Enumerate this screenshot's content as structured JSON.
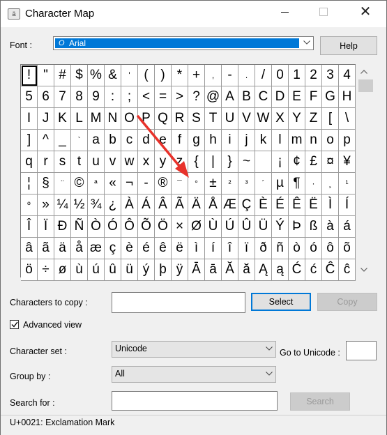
{
  "window": {
    "title": "Character Map",
    "icon_name": "character-map-app-icon"
  },
  "font": {
    "label": "Font :",
    "selected": "Arial",
    "font_type_icon": "opentype-font-icon",
    "help_label": "Help"
  },
  "grid": {
    "selected_char": "!",
    "rows": [
      [
        "!",
        "\"",
        "#",
        "$",
        "%",
        "&",
        "'",
        "(",
        ")",
        "*",
        "+",
        ",",
        "-",
        ".",
        "/",
        "0",
        "1",
        "2",
        "3",
        "4"
      ],
      [
        "5",
        "6",
        "7",
        "8",
        "9",
        ":",
        ";",
        "<",
        "=",
        ">",
        "?",
        "@",
        "A",
        "B",
        "C",
        "D",
        "E",
        "F",
        "G",
        "H"
      ],
      [
        "I",
        "J",
        "K",
        "L",
        "M",
        "N",
        "O",
        "P",
        "Q",
        "R",
        "S",
        "T",
        "U",
        "V",
        "W",
        "X",
        "Y",
        "Z",
        "[",
        "\\"
      ],
      [
        "]",
        "^",
        "_",
        "`",
        "a",
        "b",
        "c",
        "d",
        "e",
        "f",
        "g",
        "h",
        "i",
        "j",
        "k",
        "l",
        "m",
        "n",
        "o",
        "p"
      ],
      [
        "q",
        "r",
        "s",
        "t",
        "u",
        "v",
        "w",
        "x",
        "y",
        "z",
        "{",
        "|",
        "}",
        "~",
        " ",
        "¡",
        "¢",
        "£",
        "¤",
        "¥"
      ],
      [
        "¦",
        "§",
        "¨",
        "©",
        "ª",
        "«",
        "¬",
        "-",
        "®",
        "¯",
        "°",
        "±",
        "²",
        "³",
        "´",
        "µ",
        "¶",
        "·",
        "¸",
        "¹"
      ],
      [
        "º",
        "»",
        "¼",
        "½",
        "¾",
        "¿",
        "À",
        "Á",
        "Â",
        "Ã",
        "Ä",
        "Å",
        "Æ",
        "Ç",
        "È",
        "É",
        "Ê",
        "Ë",
        "Ì",
        "Í"
      ],
      [
        "Î",
        "Ï",
        "Ð",
        "Ñ",
        "Ò",
        "Ó",
        "Ô",
        "Õ",
        "Ö",
        "×",
        "Ø",
        "Ù",
        "Ú",
        "Û",
        "Ü",
        "Ý",
        "Þ",
        "ß",
        "à",
        "á"
      ],
      [
        "â",
        "ã",
        "ä",
        "å",
        "æ",
        "ç",
        "è",
        "é",
        "ê",
        "ë",
        "ì",
        "í",
        "î",
        "ï",
        "ð",
        "ñ",
        "ò",
        "ó",
        "ô",
        "õ"
      ],
      [
        "ö",
        "÷",
        "ø",
        "ù",
        "ú",
        "û",
        "ü",
        "ý",
        "þ",
        "ÿ",
        "Ā",
        "ā",
        "Ă",
        "ă",
        "Ą",
        "ą",
        "Ć",
        "ć",
        "Ĉ",
        "ĉ"
      ]
    ]
  },
  "scrollbar": {
    "up_icon": "scroll-up-arrow-icon",
    "down_icon": "scroll-down-arrow-icon"
  },
  "copy": {
    "label": "Characters to copy :",
    "value": "",
    "select_label": "Select",
    "copy_label": "Copy"
  },
  "advanced_view": {
    "label": "Advanced view",
    "checked": true
  },
  "character_set": {
    "label": "Character set :",
    "value": "Unicode"
  },
  "goto_unicode": {
    "label": "Go to Unicode :",
    "value": ""
  },
  "group_by": {
    "label": "Group by :",
    "value": "All"
  },
  "search": {
    "label": "Search for :",
    "value": "",
    "button_label": "Search"
  },
  "status": {
    "text": "U+0021: Exclamation Mark"
  },
  "colors": {
    "accent": "#0078d7",
    "annotation_arrow": "#e8322b"
  }
}
